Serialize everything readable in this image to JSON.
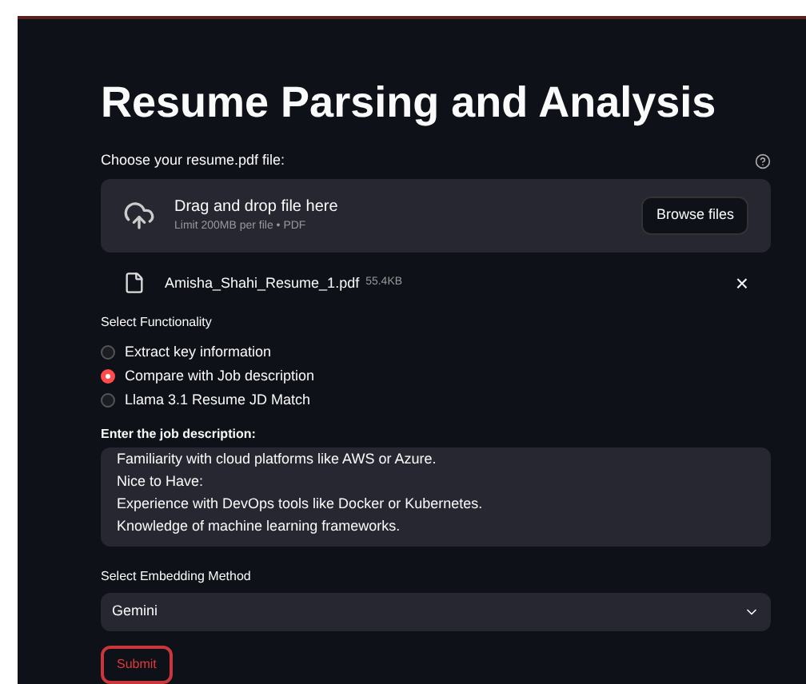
{
  "title": "Resume Parsing and Analysis",
  "uploader": {
    "label": "Choose your resume.pdf file:",
    "drop_text": "Drag and drop file here",
    "limit_text": "Limit 200MB per file • PDF",
    "button": "Browse files"
  },
  "file": {
    "name": "Amisha_Shahi_Resume_1.pdf",
    "size": "55.4KB",
    "remove": "×"
  },
  "functionality": {
    "label": "Select Functionality",
    "options": [
      {
        "label": "Extract key information",
        "selected": false
      },
      {
        "label": "Compare with Job description",
        "selected": true
      },
      {
        "label": "Llama 3.1 Resume JD Match",
        "selected": false
      }
    ]
  },
  "job_description": {
    "label": "Enter the job description:",
    "value": "Familiarity with cloud platforms like AWS or Azure.\nNice to Have:\nExperience with DevOps tools like Docker or Kubernetes.\nKnowledge of machine learning frameworks."
  },
  "embedding": {
    "label": "Select Embedding Method",
    "value": "Gemini"
  },
  "submit": "Submit"
}
